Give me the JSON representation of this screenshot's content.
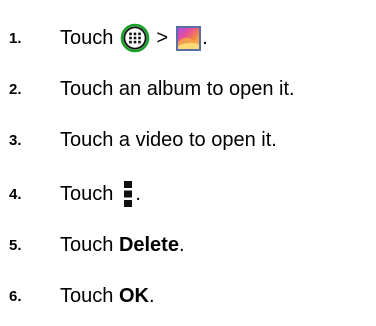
{
  "steps": [
    {
      "number": "1.",
      "before": "Touch",
      "separator": ">",
      "after": ".",
      "icons": [
        "apps-icon",
        "gallery-icon"
      ]
    },
    {
      "number": "2.",
      "text": "Touch an album to open it."
    },
    {
      "number": "3.",
      "text": "Touch a video to open it."
    },
    {
      "number": "4.",
      "before": "Touch",
      "after": ".",
      "icons": [
        "menu-icon"
      ]
    },
    {
      "number": "5.",
      "before": "Touch ",
      "bold": "Delete",
      "after": "."
    },
    {
      "number": "6.",
      "before": "Touch ",
      "bold": "OK",
      "after": "."
    }
  ],
  "colors": {
    "text": "#000000",
    "apps_icon_ring": "#1a9e2a",
    "gallery_icon_border": "#5a6ea8"
  }
}
